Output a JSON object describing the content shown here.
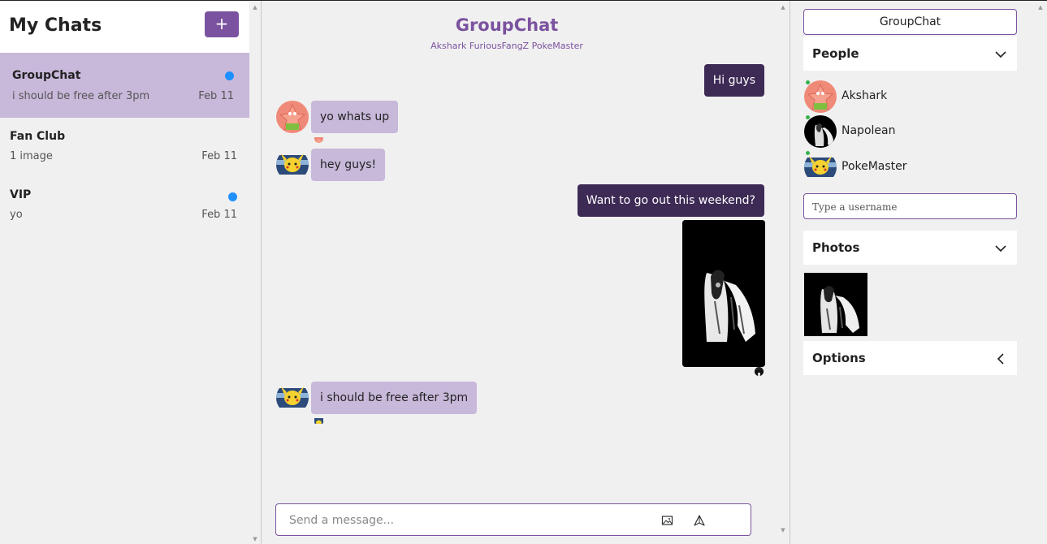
{
  "sidebar": {
    "title": "My Chats",
    "new_chat_label": "+",
    "chats": [
      {
        "name": "GroupChat",
        "preview": "i should be free after 3pm",
        "date": "Feb 11",
        "unread": true,
        "active": true
      },
      {
        "name": "Fan Club",
        "preview": "1 image",
        "date": "Feb 11",
        "unread": false,
        "active": false
      },
      {
        "name": "VIP",
        "preview": "yo",
        "date": "Feb 11",
        "unread": true,
        "active": false
      }
    ]
  },
  "chat": {
    "title": "GroupChat",
    "members": "Akshark FuriousFangZ PokeMaster",
    "messages": [
      {
        "from": "me",
        "text": "Hi guys"
      },
      {
        "from": "Akshark",
        "text": "yo whats up"
      },
      {
        "from": "PokeMaster",
        "text": "hey guys!"
      },
      {
        "from": "me",
        "text": "Want to go out this weekend?"
      },
      {
        "from": "me",
        "type": "image"
      },
      {
        "from": "PokeMaster",
        "text": "i should be free after 3pm"
      }
    ],
    "composer": {
      "placeholder": "Send a message...",
      "image_icon": "image-icon",
      "send_icon": "send-icon"
    }
  },
  "details": {
    "group_name": "GroupChat",
    "people_label": "People",
    "people": [
      {
        "name": "Akshark",
        "avatar": "starfish-avatar"
      },
      {
        "name": "Napolean",
        "avatar": "dark-avatar"
      },
      {
        "name": "PokeMaster",
        "avatar": "pikachu-avatar"
      }
    ],
    "username_placeholder": "Type a username",
    "photos_label": "Photos",
    "options_label": "Options"
  },
  "colors": {
    "accent": "#7b529f",
    "own_bubble": "#3d2a55",
    "other_bubble": "#c8b8da",
    "unread": "#1e90ff",
    "online": "#35b24d"
  }
}
